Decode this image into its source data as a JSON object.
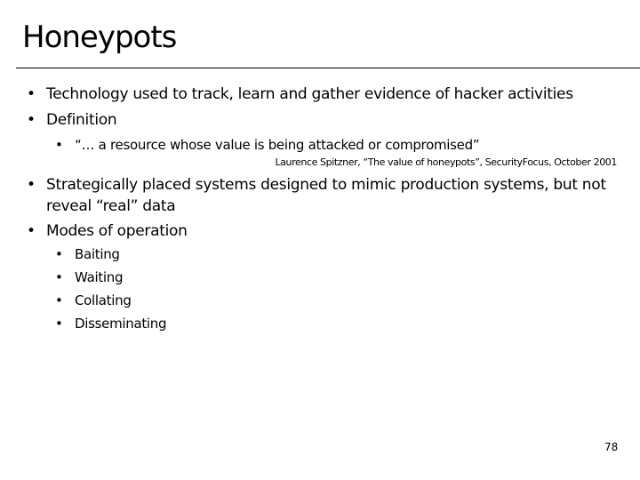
{
  "slide": {
    "title": "Honeypots",
    "bullets": [
      "Technology used to track, learn and gather evidence of hacker activities",
      "Definition",
      "Strategically placed systems designed to mimic production systems, but not reveal “real” data",
      "Modes of operation"
    ],
    "definition_quote": "“… a resource whose value is being attacked or compromised”",
    "citation": "Laurence Spitzner, “The value of honeypots”, SecurityFocus, October 2001",
    "modes": [
      "Baiting",
      "Waiting",
      "Collating",
      "Disseminating"
    ],
    "bullet_glyph": "•",
    "page_number": "78"
  }
}
